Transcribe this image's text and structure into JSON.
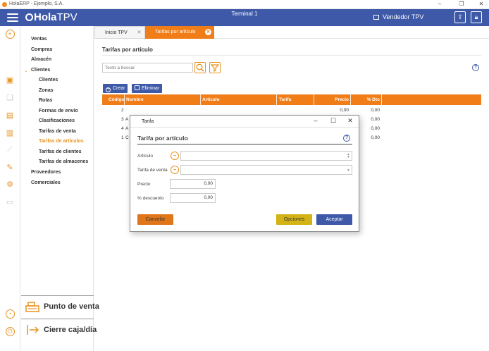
{
  "os": {
    "title": "HolaERP - Ejemplo, S.A."
  },
  "header": {
    "brand_hola": "Hola",
    "brand_tpv": "TPV",
    "terminal": "Terminal 1",
    "user": "Vendedor TPV",
    "colors": {
      "header": "#3d59a8",
      "accent": "#f07d17"
    }
  },
  "nav": {
    "items": {
      "ventas": "Ventas",
      "compras": "Compras",
      "almacen": "Almacén",
      "clientes": "Clientes",
      "proveedores": "Proveedores",
      "comerciales": "Comerciales"
    },
    "clientes_sub": {
      "clientes": "Clientes",
      "zonas": "Zonas",
      "rutas": "Rutas",
      "formas_envio": "Formas de envío",
      "clasificaciones": "Clasificaciones",
      "tarifas_venta": "Tarifas de venta",
      "tarifas_articulos": "Tarifas de artículos",
      "tarifas_clientes": "Tarifas de clientes",
      "tarifas_almacenes": "Tarifas de almacenes"
    },
    "punto_venta": "Punto de venta",
    "cierre_caja": "Cierre caja/día"
  },
  "tabs": {
    "inicio": "Inicio TPV",
    "tarifas": "Tarifas por artículo"
  },
  "page": {
    "title": "Tarifas por artículo",
    "search_placeholder": "Texto a buscar",
    "crear": "Crear",
    "eliminar": "Eliminar"
  },
  "table": {
    "headers": {
      "codigo": "Código",
      "nombre": "Nombre",
      "articulo": "Artículo",
      "tarifa": "Tarifa",
      "precio": "Precio",
      "dto": "% Dto"
    },
    "rows": [
      {
        "codigo": "2",
        "nombre": "",
        "precio": "0,00",
        "dto": "0,00"
      },
      {
        "codigo": "3",
        "nombre": "A",
        "precio": "",
        "dto": "0,00"
      },
      {
        "codigo": "4",
        "nombre": "A",
        "precio": "",
        "dto": "0,00"
      },
      {
        "codigo": "1",
        "nombre": "C",
        "precio": "",
        "dto": "0,00"
      }
    ]
  },
  "dialog": {
    "title": "Tarifa",
    "heading": "Tarifa por artículo",
    "labels": {
      "articulo": "Artículo",
      "tarifa_venta": "Tarifa de venta",
      "precio": "Precio",
      "descuento": "% descuento"
    },
    "values": {
      "precio": "0,00",
      "descuento": "0,00"
    },
    "buttons": {
      "cancelar": "Cancelar",
      "opciones": "Opciones",
      "aceptar": "Aceptar"
    }
  }
}
